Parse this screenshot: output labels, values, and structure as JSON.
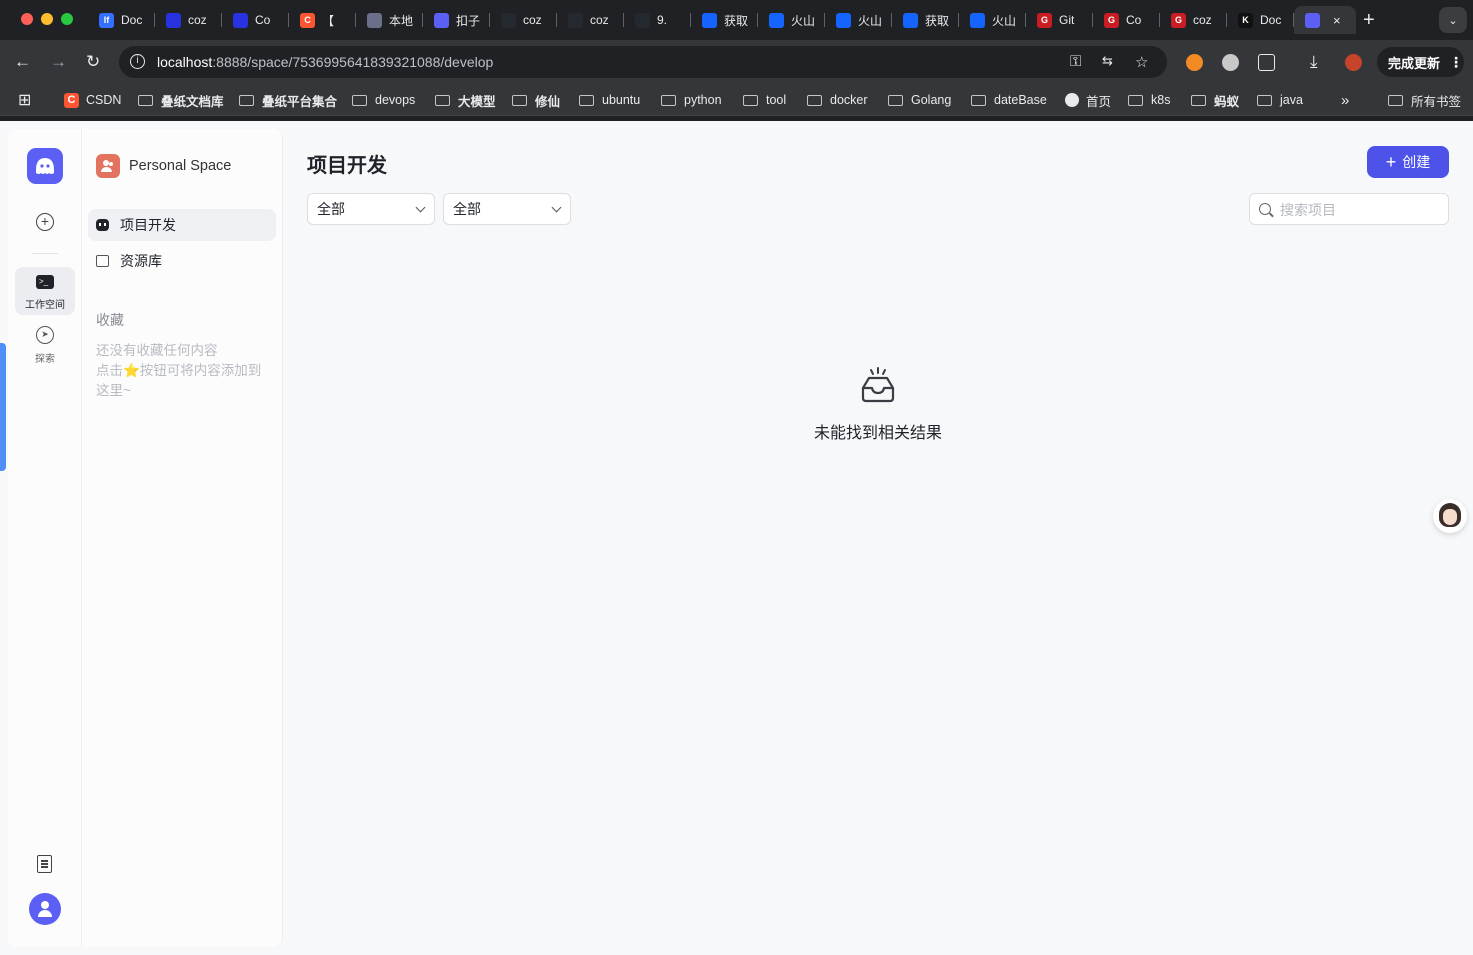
{
  "browser": {
    "tabs": [
      {
        "title": "Doc",
        "icon": "feishu-doc-icon",
        "color": "#3370ff",
        "glyph": "lf"
      },
      {
        "title": "coz",
        "icon": "baidu-paw-icon",
        "color": "#2932e1",
        "glyph": ""
      },
      {
        "title": "Co",
        "icon": "baidu-paw-icon",
        "color": "#2932e1",
        "glyph": ""
      },
      {
        "title": "【",
        "icon": "csdn-icon",
        "color": "#fc5531",
        "glyph": "C"
      },
      {
        "title": "本地",
        "icon": "tool-icon",
        "color": "#6b6f8a",
        "glyph": ""
      },
      {
        "title": "扣子",
        "icon": "coze-icon",
        "color": "#5b5ff4",
        "glyph": ""
      },
      {
        "title": "coz",
        "icon": "github-icon",
        "color": "#24292f",
        "glyph": ""
      },
      {
        "title": "coz",
        "icon": "github-icon",
        "color": "#24292f",
        "glyph": ""
      },
      {
        "title": "9.",
        "icon": "github-icon",
        "color": "#24292f",
        "glyph": ""
      },
      {
        "title": "获取",
        "icon": "volcengine-icon",
        "color": "#1664ff",
        "glyph": ""
      },
      {
        "title": "火山",
        "icon": "volcengine-icon",
        "color": "#1664ff",
        "glyph": ""
      },
      {
        "title": "火山",
        "icon": "volcengine-icon",
        "color": "#1664ff",
        "glyph": ""
      },
      {
        "title": "获取",
        "icon": "volcengine-icon",
        "color": "#1664ff",
        "glyph": ""
      },
      {
        "title": "火山",
        "icon": "volcengine-icon",
        "color": "#1664ff",
        "glyph": ""
      },
      {
        "title": "Git",
        "icon": "gitee-icon",
        "color": "#c71d23",
        "glyph": "G"
      },
      {
        "title": "Co",
        "icon": "gitee-icon",
        "color": "#c71d23",
        "glyph": "G"
      },
      {
        "title": "coz",
        "icon": "gitee-icon",
        "color": "#c71d23",
        "glyph": "G"
      },
      {
        "title": "Doc",
        "icon": "kimi-icon",
        "color": "#111111",
        "glyph": "K"
      }
    ],
    "active_tab": {
      "icon": "coze-icon",
      "color": "#5b5ff4",
      "close": "×"
    },
    "new_tab": "+",
    "url_host": "localhost",
    "url_path": ":8888/space/7536995641839321088/develop",
    "update_button": "完成更新",
    "bookmarks": [
      {
        "label": "CSDN",
        "kind": "csdn"
      },
      {
        "label": "叠纸文档库",
        "kind": "folder"
      },
      {
        "label": "叠纸平台集合",
        "kind": "folder"
      },
      {
        "label": "devops",
        "kind": "folder"
      },
      {
        "label": "大模型",
        "kind": "folder"
      },
      {
        "label": "修仙",
        "kind": "folder"
      },
      {
        "label": "ubuntu",
        "kind": "folder"
      },
      {
        "label": "python",
        "kind": "folder"
      },
      {
        "label": "tool",
        "kind": "folder"
      },
      {
        "label": "docker",
        "kind": "folder"
      },
      {
        "label": "Golang",
        "kind": "folder"
      },
      {
        "label": "dateBase",
        "kind": "folder"
      },
      {
        "label": "首页",
        "kind": "globe"
      },
      {
        "label": "k8s",
        "kind": "folder"
      },
      {
        "label": "蚂蚁",
        "kind": "folder"
      },
      {
        "label": "java",
        "kind": "folder"
      }
    ],
    "bookmarks_more": "»",
    "all_bookmarks": "所有书签"
  },
  "rail": {
    "workspace_label": "工作空间",
    "explore_label": "探索",
    "accent": "#5b5ff4"
  },
  "sidebar": {
    "space_name": "Personal Space",
    "items": [
      {
        "label": "项目开发",
        "active": true
      },
      {
        "label": "资源库",
        "active": false
      }
    ],
    "favorites_title": "收藏",
    "favorites_empty_line1": "还没有收藏任何内容",
    "favorites_empty_line2": "点击⭐按钮可将内容添加到",
    "favorites_empty_line3": "这里~"
  },
  "main": {
    "title": "项目开发",
    "create_label": "创建",
    "filter1": "全部",
    "filter2": "全部",
    "search_placeholder": "搜索项目",
    "empty_text": "未能找到相关结果",
    "button_color": "#4d53e8"
  }
}
